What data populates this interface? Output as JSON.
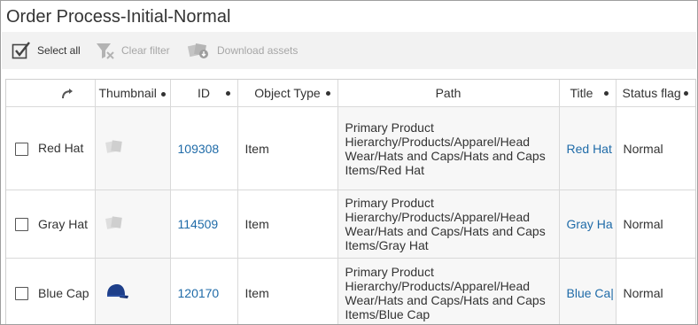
{
  "page_title": "Order Process-Initial-Normal",
  "toolbar": {
    "select_all": "Select all",
    "clear_filter": "Clear filter",
    "download_assets": "Download assets"
  },
  "table": {
    "columns": {
      "thumbnail": "Thumbnail",
      "id": "ID",
      "object_type": "Object Type",
      "path": "Path",
      "title": "Title",
      "status_flag": "Status flag"
    },
    "rows": [
      {
        "name": "Red Hat",
        "thumbnail_icon": "placeholder-image-icon",
        "id": "109308",
        "object_type": "Item",
        "path_lines": [
          "Primary Product",
          "Hierarchy/Products/Apparel/Head",
          "Wear/Hats and Caps/Hats and Caps",
          "Items/Red Hat"
        ],
        "title": "Red Hat",
        "status": "Normal"
      },
      {
        "name": "Gray Hat",
        "thumbnail_icon": "placeholder-image-icon",
        "id": "114509",
        "object_type": "Item",
        "path_lines": [
          "Primary Product",
          "Hierarchy/Products/Apparel/Head",
          "Wear/Hats and Caps/Hats and Caps",
          "Items/Gray Hat"
        ],
        "title": "Gray Ha",
        "status": "Normal"
      },
      {
        "name": "Blue Cap",
        "thumbnail_icon": "blue-cap-image",
        "id": "120170",
        "object_type": "Item",
        "path_lines": [
          "Primary Product",
          "Hierarchy/Products/Apparel/Head",
          "Wear/Hats and Caps/Hats and Caps",
          "Items/Blue Cap"
        ],
        "title": "Blue Ca|",
        "status": "Normal"
      }
    ]
  },
  "colors": {
    "link": "#1f6ba8",
    "toolbar_bg": "#f2f2f2",
    "disabled_text": "#a6a6a6"
  }
}
